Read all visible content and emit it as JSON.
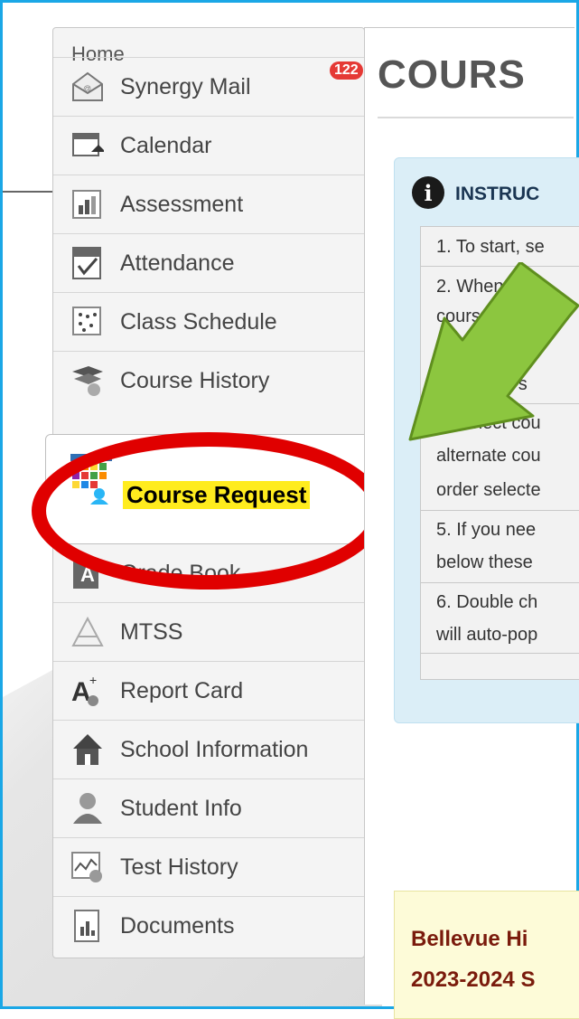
{
  "sidebar": {
    "home_label": "Home",
    "items": [
      {
        "label": "Synergy Mail",
        "icon": "mail-icon",
        "badge": "122"
      },
      {
        "label": "Calendar",
        "icon": "calendar-icon"
      },
      {
        "label": "Assessment",
        "icon": "assessment-icon"
      },
      {
        "label": "Attendance",
        "icon": "attendance-icon"
      },
      {
        "label": "Class Schedule",
        "icon": "class-schedule-icon"
      },
      {
        "label": "Course History",
        "icon": "course-history-icon"
      },
      {
        "label": "Course Request",
        "icon": "course-request-icon",
        "active": true
      },
      {
        "label": "Grade Book",
        "icon": "grade-book-icon"
      },
      {
        "label": "MTSS",
        "icon": "mtss-icon"
      },
      {
        "label": "Report Card",
        "icon": "report-card-icon"
      },
      {
        "label": "School Information",
        "icon": "school-info-icon"
      },
      {
        "label": "Student Info",
        "icon": "student-info-icon"
      },
      {
        "label": "Test History",
        "icon": "test-history-icon"
      },
      {
        "label": "Documents",
        "icon": "documents-icon"
      }
    ]
  },
  "main": {
    "title": "COURS",
    "instructions": {
      "heading": "INSTRUC",
      "steps": [
        "1. To start, se",
        "2. When se",
        "cours",
        "ime s",
        "4. Select cou",
        "alternate cou",
        "order selecte",
        "5. If you nee",
        "below these",
        "6. Double ch",
        "will auto-pop"
      ]
    },
    "school_lines": [
      "Bellevue Hi",
      "2023-2024 S"
    ]
  },
  "colors": {
    "frame": "#1aa7e6",
    "highlight": "#ffec1e",
    "oval": "#e00000",
    "arrow": "#8cc63f",
    "badge": "#e53935"
  }
}
